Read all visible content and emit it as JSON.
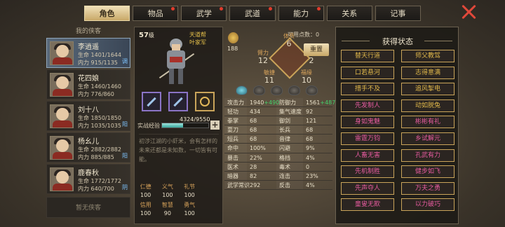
{
  "tabs": [
    {
      "label": "角色",
      "active": true,
      "dot": false
    },
    {
      "label": "物品",
      "dot": true
    },
    {
      "label": "武学",
      "dot": true
    },
    {
      "label": "武道",
      "dot": true
    },
    {
      "label": "能力",
      "dot": true
    },
    {
      "label": "关系",
      "dot": false
    },
    {
      "label": "记事",
      "dot": false
    }
  ],
  "team_title": "我的侠客",
  "characters": [
    {
      "name": "李逍遥",
      "hp_label": "生命",
      "hp": "1401/1644",
      "mp_label": "内力",
      "mp": "915/1135",
      "tag": "调",
      "selected": true
    },
    {
      "name": "花四娘",
      "hp_label": "生命",
      "hp": "1460/1460",
      "mp_label": "内力",
      "mp": "776/860",
      "tag": ""
    },
    {
      "name": "刘十八",
      "hp_label": "生命",
      "hp": "1850/1850",
      "mp_label": "内力",
      "mp": "1035/1035",
      "tag": "阳"
    },
    {
      "name": "杨幺儿",
      "hp_label": "生命",
      "hp": "2882/2882",
      "mp_label": "内力",
      "mp": "885/885",
      "tag": "阳"
    },
    {
      "name": "鹿春秋",
      "hp_label": "生命",
      "hp": "1772/1772",
      "mp_label": "内力",
      "mp": "640/700",
      "tag": "阴"
    }
  ],
  "no_more": "暂无侠客",
  "hero": {
    "level": "57",
    "level_unit": "级",
    "sect1": "天道帮",
    "sect2": "叶家军",
    "xp_label": "实战经验",
    "xp": "4324/9550",
    "xp_fraction": 0.45,
    "desc": "初涉江湖的小虾米，会有怎样的未来还都是未知数，一切皆有可能。"
  },
  "virtues": [
    {
      "k": "仁德",
      "v": "100"
    },
    {
      "k": "义气",
      "v": "100"
    },
    {
      "k": "礼节",
      "v": "100"
    },
    {
      "k": "信用",
      "v": "100"
    },
    {
      "k": "智慧",
      "v": "90"
    },
    {
      "k": "勇气",
      "v": "100"
    }
  ],
  "attrs": {
    "points_label": "可用点数：",
    "points": "0",
    "potential": "188",
    "tizhi": "体质",
    "tizhi_v": "6",
    "bili": "臂力",
    "bili_v": "12",
    "xingge": "悟性",
    "xingge_v": "2",
    "minjie": "敏捷",
    "minjie_v": "11",
    "fuyuan": "福缘",
    "fuyuan_v": "10",
    "reset": "重置"
  },
  "stats": [
    [
      "攻击力",
      "1940",
      "+490",
      "防御力",
      "1561",
      "+487"
    ],
    [
      "轻功",
      "434",
      "",
      "集气速度",
      "92",
      ""
    ],
    [
      "拳掌",
      "68",
      "",
      "御剑",
      "121",
      ""
    ],
    [
      "耍刀",
      "68",
      "",
      "长兵",
      "68",
      ""
    ],
    [
      "短兵",
      "68",
      "",
      "音律",
      "68",
      ""
    ],
    [
      "命中",
      "100%",
      "",
      "闪避",
      "9%",
      ""
    ],
    [
      "暴击",
      "22%",
      "",
      "格挡",
      "4%",
      ""
    ],
    [
      "医术",
      "28",
      "",
      "毒术",
      "0",
      ""
    ],
    [
      "暗器",
      "82",
      "",
      "连击",
      "23%",
      ""
    ],
    [
      "武学常识",
      "292",
      "",
      "反击",
      "4%",
      ""
    ]
  ],
  "buff_title": "获得状态",
  "buffs": [
    {
      "label": "替天行道",
      "pink": false
    },
    {
      "label": "师父教驾",
      "pink": false
    },
    {
      "label": "口若悬河",
      "pink": false
    },
    {
      "label": "志得意满",
      "pink": false
    },
    {
      "label": "措手不及",
      "pink": false
    },
    {
      "label": "追风掣电",
      "pink": false
    },
    {
      "label": "先发制人",
      "pink": true
    },
    {
      "label": "动如脱兔",
      "pink": false
    },
    {
      "label": "身如鬼魅",
      "pink": true
    },
    {
      "label": "彬彬有礼",
      "pink": true
    },
    {
      "label": "雷霆万钧",
      "pink": true
    },
    {
      "label": "乡试解元",
      "pink": true
    },
    {
      "label": "人畜无害",
      "pink": true
    },
    {
      "label": "孔武有力",
      "pink": true
    },
    {
      "label": "先机制胜",
      "pink": true
    },
    {
      "label": "健步如飞",
      "pink": true
    },
    {
      "label": "先声夺人",
      "pink": true
    },
    {
      "label": "万夫之勇",
      "pink": true
    },
    {
      "label": "童叟无欺",
      "pink": true
    },
    {
      "label": "以力破巧",
      "pink": true
    }
  ]
}
